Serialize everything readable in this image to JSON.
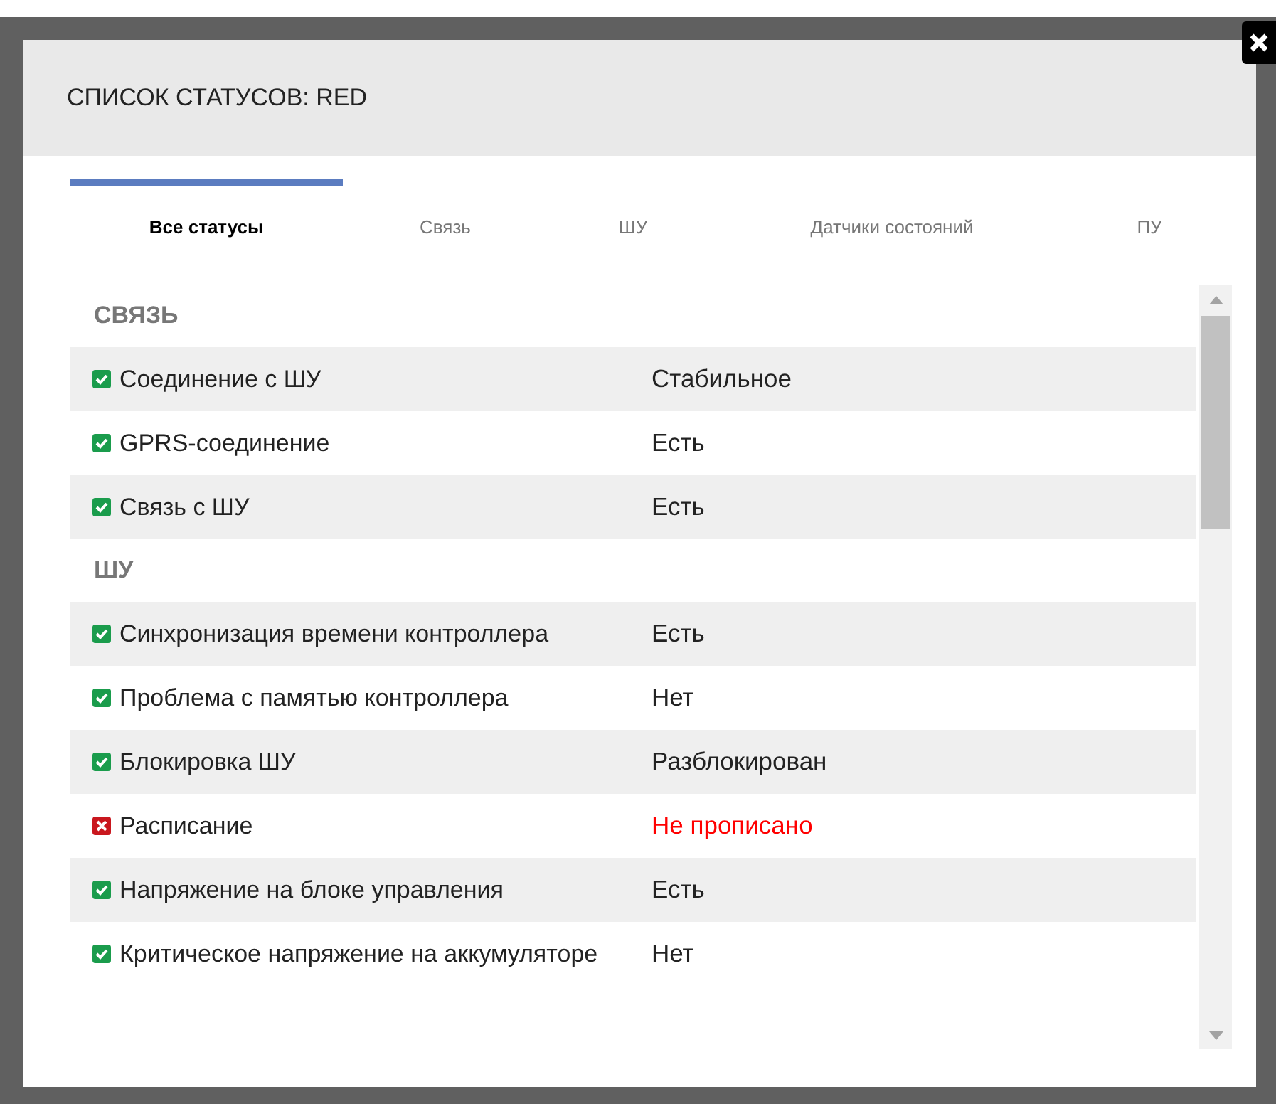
{
  "dialog": {
    "title": "СПИСОК СТАТУСОВ: RED"
  },
  "tabs": [
    {
      "label": "Все статусы",
      "selected": true
    },
    {
      "label": "Связь",
      "selected": false
    },
    {
      "label": "ШУ",
      "selected": false
    },
    {
      "label": "Датчики состояний",
      "selected": false
    },
    {
      "label": "ПУ",
      "selected": false
    }
  ],
  "sections": [
    {
      "title": "СВЯЗЬ",
      "rows": [
        {
          "label": "Соединение с ШУ",
          "value": "Стабильное",
          "ok": true
        },
        {
          "label": "GPRS-соединение",
          "value": "Есть",
          "ok": true
        },
        {
          "label": "Связь с ШУ",
          "value": "Есть",
          "ok": true
        }
      ]
    },
    {
      "title": "ШУ",
      "rows": [
        {
          "label": "Синхронизация времени контроллера",
          "value": "Есть",
          "ok": true
        },
        {
          "label": "Проблема с памятью контроллера",
          "value": "Нет",
          "ok": true
        },
        {
          "label": "Блокировка ШУ",
          "value": "Разблокирован",
          "ok": true
        },
        {
          "label": "Расписание",
          "value": "Не прописано",
          "ok": false
        },
        {
          "label": "Напряжение на блоке управления",
          "value": "Есть",
          "ok": true
        },
        {
          "label": "Критическое напряжение на аккумуляторе",
          "value": "Нет",
          "ok": true
        }
      ]
    }
  ]
}
